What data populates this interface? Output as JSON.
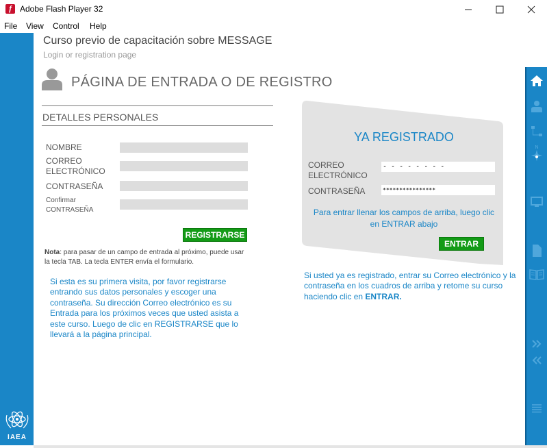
{
  "window": {
    "title": "Adobe Flash Player 32",
    "app_icon": "flash-icon",
    "minimize": "—",
    "maximize": "☐",
    "close": "✕"
  },
  "menu": [
    "File",
    "View",
    "Control",
    "Help"
  ],
  "header": {
    "course_title": "Curso previo de capacitación sobre MESSAGE",
    "subtitle": "Login or registration page",
    "page_heading": "PÁGINA DE ENTRADA O DE REGISTRO"
  },
  "registration": {
    "section_title": "DETALLES PERSONALES",
    "fields": [
      {
        "label": "NOMBRE",
        "value": ""
      },
      {
        "label": "CORREO\nELECTRÓNICO",
        "value": ""
      },
      {
        "label": "CONTRASEÑA",
        "value": ""
      },
      {
        "label": "Confirmar\nCONTRASEÑA",
        "value": ""
      }
    ],
    "button": "REGISTRARSE",
    "note_bold": "Nota",
    "note_text": ": para pasar de un campo de entrada al próximo, puede usar la tecla TAB. La tecla ENTER envía el formulario.",
    "info": "Si esta es su primera visita, por favor registrarse entrando sus datos personales y escoger una contraseña. Su dirección Correo electrónico es su Entrada para los próximos veces que usted asista a este curso. Luego de clic en REGISTRARSE que lo llevará a la página principal."
  },
  "login": {
    "title": "YA REGISTRADO",
    "email_label": "CORREO\nELECTRÓNICO",
    "email_value": "- - - - - - - -",
    "password_label": "CONTRASEÑA",
    "password_value": "****************",
    "card_info": "Para entrar llenar los campos de arriba, luego clic en ENTRAR abajo",
    "button": "ENTRAR",
    "info_text": "Si usted ya es registrado, entrar su Correo electrónico y la contraseña en los cuadros de arriba y retome su curso haciendo clic en ",
    "info_bold": "ENTRAR."
  },
  "logo": {
    "text": "IAEA"
  },
  "sidebar_icons": [
    "home-icon",
    "user-icon",
    "sitemap-icon",
    "compass-icon",
    "monitor-icon",
    "document-icon",
    "book-icon",
    "next-icon",
    "previous-icon",
    "menu-icon"
  ],
  "colors": {
    "accent": "#1a86c7",
    "button": "#139b16",
    "card": "#e3e3e3"
  }
}
